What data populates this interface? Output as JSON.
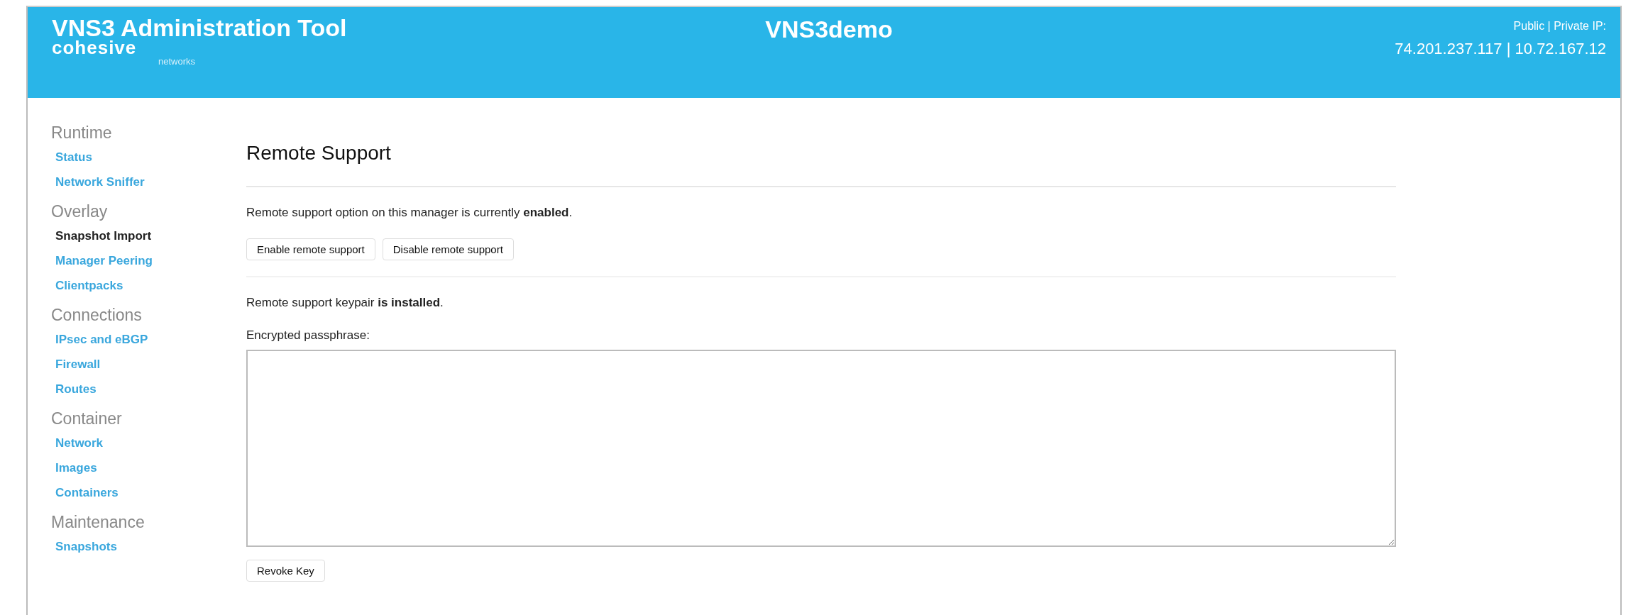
{
  "header": {
    "title": "VNS3 Administration Tool",
    "logo": {
      "brand": "cohesive",
      "tagline": "networks"
    },
    "manager_name": "VNS3demo",
    "ip_label": "Public | Private IP:",
    "ip_value": "74.201.237.117 | 10.72.167.12"
  },
  "sidebar": [
    {
      "heading": "Runtime",
      "items": [
        {
          "label": "Status",
          "selected": false
        },
        {
          "label": "Network Sniffer",
          "selected": false
        }
      ]
    },
    {
      "heading": "Overlay",
      "items": [
        {
          "label": "Snapshot Import",
          "selected": true
        },
        {
          "label": "Manager Peering",
          "selected": false
        },
        {
          "label": "Clientpacks",
          "selected": false
        }
      ]
    },
    {
      "heading": "Connections",
      "items": [
        {
          "label": "IPsec and eBGP",
          "selected": false
        },
        {
          "label": "Firewall",
          "selected": false
        },
        {
          "label": "Routes",
          "selected": false
        }
      ]
    },
    {
      "heading": "Container",
      "items": [
        {
          "label": "Network",
          "selected": false
        },
        {
          "label": "Images",
          "selected": false
        },
        {
          "label": "Containers",
          "selected": false
        }
      ]
    },
    {
      "heading": "Maintenance",
      "items": [
        {
          "label": "Snapshots",
          "selected": false
        }
      ]
    }
  ],
  "main": {
    "title": "Remote Support",
    "status_text": "Remote support option on this manager is currently **enabled**.",
    "buttons": [
      "Enable remote support",
      "Disable remote support"
    ],
    "keypair_text": "Remote support keypair **is installed**.",
    "passphrase_label": "Encrypted passphrase:",
    "revoke_button": "Revoke Key"
  }
}
